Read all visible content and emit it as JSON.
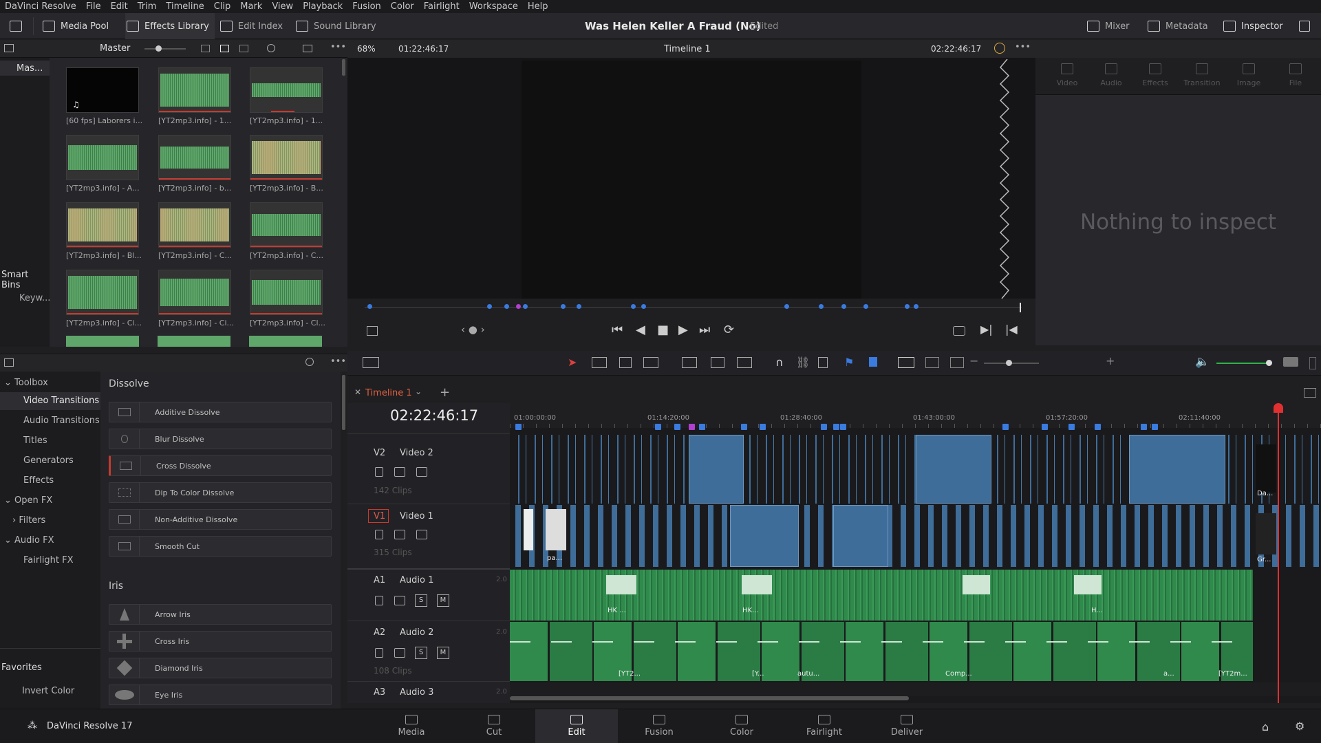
{
  "menu": {
    "app": "DaVinci Resolve",
    "items": [
      "File",
      "Edit",
      "Trim",
      "Timeline",
      "Clip",
      "Mark",
      "View",
      "Playback",
      "Fusion",
      "Color",
      "Fairlight",
      "Workspace",
      "Help"
    ]
  },
  "topbar": {
    "media_pool": "Media Pool",
    "effects_library": "Effects Library",
    "edit_index": "Edit Index",
    "sound_library": "Sound Library",
    "project_title": "Was Helen Keller A Fraud (No)",
    "project_status": "Edited",
    "mixer": "Mixer",
    "metadata": "Metadata",
    "inspector": "Inspector"
  },
  "media_pool": {
    "bin": "Master",
    "bins": [
      "Mas...",
      "Smart Bins",
      "Keyw..."
    ],
    "clips": [
      "[60 fps] Laborers i...",
      "[YT2mp3.info] - 1...",
      "[YT2mp3.info] - 1...",
      "[YT2mp3.info] - A...",
      "[YT2mp3.info] - b...",
      "[YT2mp3.info] - B...",
      "[YT2mp3.info] - Bl...",
      "[YT2mp3.info] - C...",
      "[YT2mp3.info] - C...",
      "[YT2mp3.info] - Ci...",
      "[YT2mp3.info] - Ci...",
      "[YT2mp3.info] - Cl..."
    ]
  },
  "viewer": {
    "zoom": "68%",
    "source_tc": "01:22:46:17",
    "timeline_name": "Timeline 1",
    "record_tc": "02:22:46:17"
  },
  "inspector": {
    "tabs": [
      "Video",
      "Audio",
      "Effects",
      "Transition",
      "Image",
      "File"
    ],
    "empty_text": "Nothing to inspect"
  },
  "effects": {
    "tree": [
      "Toolbox",
      "Video Transitions",
      "Audio Transitions",
      "Titles",
      "Generators",
      "Effects",
      "Open FX",
      "Filters",
      "Audio FX",
      "Fairlight FX"
    ],
    "favorites_label": "Favorites",
    "favorites": [
      "Invert Color"
    ],
    "dissolve_header": "Dissolve",
    "dissolve": [
      "Additive Dissolve",
      "Blur Dissolve",
      "Cross Dissolve",
      "Dip To Color Dissolve",
      "Non-Additive Dissolve",
      "Smooth Cut"
    ],
    "iris_header": "Iris",
    "iris": [
      "Arrow Iris",
      "Cross Iris",
      "Diamond Iris",
      "Eye Iris"
    ]
  },
  "timeline": {
    "tab": "Timeline 1",
    "timecode": "02:22:46:17",
    "ruler": [
      "01:00:00:00",
      "01:14:20:00",
      "01:28:40:00",
      "01:43:00:00",
      "01:57:20:00",
      "02:11:40:00"
    ],
    "tracks": [
      {
        "id": "V2",
        "name": "Video 2",
        "sub": "142 Clips"
      },
      {
        "id": "V1",
        "name": "Video 1",
        "sub": "315 Clips"
      },
      {
        "id": "A1",
        "name": "Audio 1",
        "ch": "2.0"
      },
      {
        "id": "A2",
        "name": "Audio 2",
        "ch": "2.0",
        "sub": "108 Clips"
      },
      {
        "id": "A3",
        "name": "Audio 3",
        "ch": "2.0"
      }
    ],
    "clip_labels": [
      "Da...",
      "Gr...",
      "pa...",
      "HK ...",
      "HK...",
      "H...",
      "[YT2...",
      "[Y...",
      "autu...",
      "Comp...",
      "a...",
      "[YT2m..."
    ]
  },
  "bottombar": {
    "app": "DaVinci Resolve 17",
    "pages": [
      "Media",
      "Cut",
      "Edit",
      "Fusion",
      "Color",
      "Fairlight",
      "Deliver"
    ],
    "active": "Edit"
  }
}
